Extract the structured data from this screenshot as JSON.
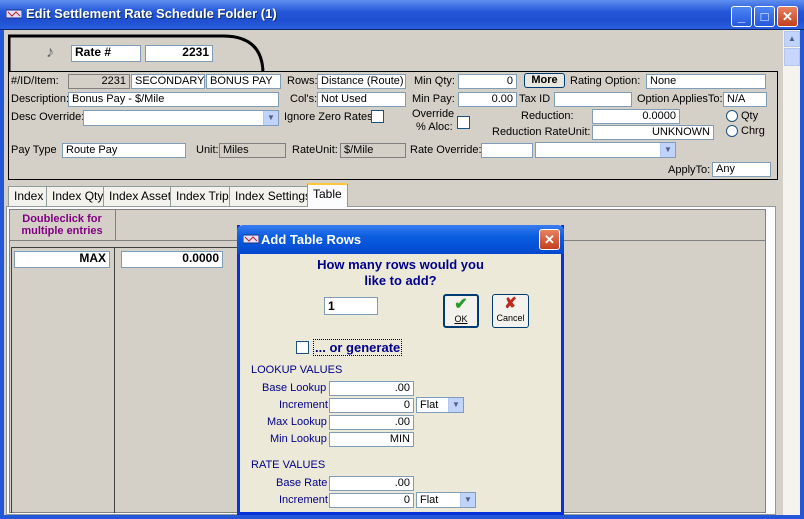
{
  "window": {
    "title": "Edit Settlement Rate Schedule Folder (1)",
    "minimize_glyph": "_",
    "maximize_glyph": "□",
    "close_glyph": "✕"
  },
  "header": {
    "rate_label": "Rate #",
    "rate_value": "2231",
    "music_glyph": "♪"
  },
  "form": {
    "id_item_label": "#/ID/Item:",
    "id_value": "2231",
    "item1": "SECONDARY",
    "item2": "BONUS PAY",
    "rows_label": "Rows:",
    "rows_value": "Distance (Route)",
    "min_qty_label": "Min Qty:",
    "min_qty_value": "0",
    "more_button": "More",
    "rating_option_label": "Rating Option:",
    "rating_option_value": "None",
    "description_label": "Description:",
    "description_value": "Bonus Pay - $/Mile",
    "cols_label": "Col's:",
    "cols_value": "Not Used",
    "min_pay_label": "Min Pay:",
    "min_pay_value": "0.00",
    "tax_id_label": "Tax ID",
    "tax_id_value": "",
    "option_applies_label": "Option AppliesTo:",
    "option_applies_value": "N/A",
    "desc_override_label": "Desc Override:",
    "desc_override_value": "",
    "ignore_zero_label": "Ignore Zero Rates",
    "override_aloc_label1": "Override",
    "override_aloc_label2": "% Aloc:",
    "reduction_label": "Reduction:",
    "reduction_value": "0.0000",
    "qty_label": "Qty",
    "reduction_rate_unit_label": "Reduction RateUnit:",
    "reduction_rate_unit_value": "UNKNOWN",
    "chrg_label": "Chrg",
    "pay_type_label": "Pay Type",
    "pay_type_value": "Route Pay",
    "unit_label": "Unit:",
    "unit_value": "Miles",
    "rate_unit_label": "RateUnit:",
    "rate_unit_value": "$/Mile",
    "rate_override_label": "Rate Override:",
    "rate_override_value1": "",
    "rate_override_value2": "",
    "apply_to_label": "ApplyTo:",
    "apply_to_value": "Any"
  },
  "tabs": [
    {
      "label": "Index"
    },
    {
      "label": "Index Qty"
    },
    {
      "label": "Index Asset"
    },
    {
      "label": "Index Trip"
    },
    {
      "label": "Index Settings"
    },
    {
      "label": "Table"
    }
  ],
  "table": {
    "hint_line1": "Doubleclick for",
    "hint_line2": "multiple entries",
    "row_key": "MAX",
    "row_value": "0.0000"
  },
  "dialog": {
    "title": "Add Table Rows",
    "question_line1": "How many rows would you",
    "question_line2": "like to add?",
    "rows_to_add": "1",
    "ok_label": "OK",
    "cancel_label": "Cancel",
    "or_generate_label": "... or generate",
    "lookup_values_heading": "LOOKUP VALUES",
    "base_lookup_label": "Base Lookup",
    "base_lookup_value": ".00",
    "increment_label": "Increment",
    "increment_value": "0",
    "increment_type": "Flat",
    "max_lookup_label": "Max Lookup",
    "max_lookup_value": ".00",
    "min_lookup_label": "Min Lookup",
    "min_lookup_value": "MIN",
    "rate_values_heading": "RATE VALUES",
    "base_rate_label": "Base Rate",
    "base_rate_value": ".00",
    "rate_increment_label": "Increment",
    "rate_increment_value": "0",
    "rate_increment_type": "Flat"
  },
  "colors": {
    "title_blue": "#2457d8",
    "hint_purple": "#800080",
    "tab_active_accent": "#ffc73c",
    "ok_green": "#2a9a2a",
    "cancel_red": "#c0281c"
  }
}
